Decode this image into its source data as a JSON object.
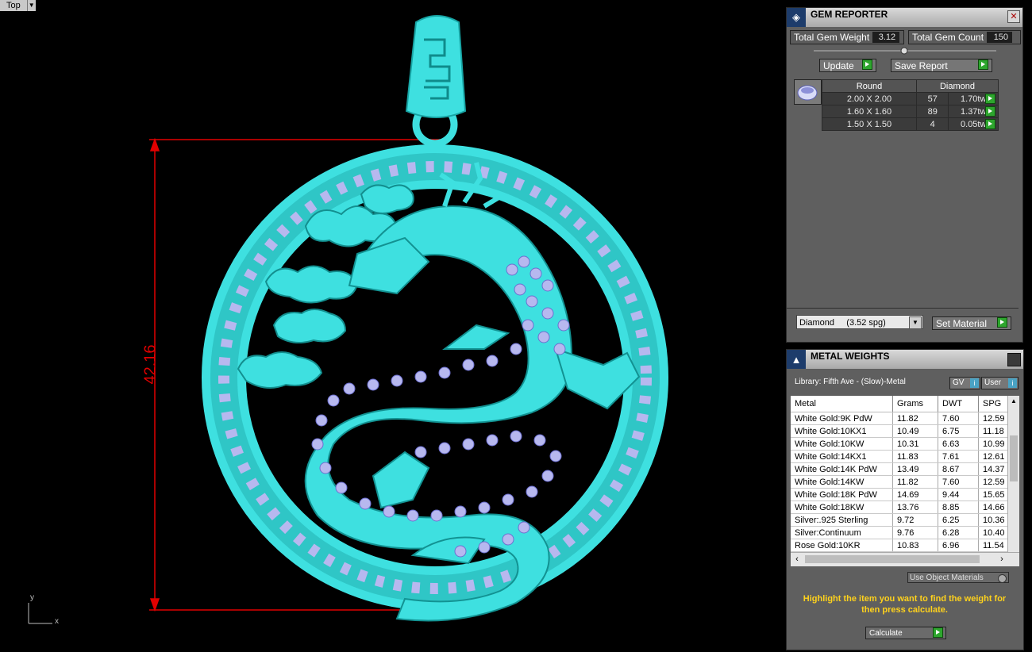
{
  "viewport": {
    "view_name": "Top",
    "dimension_value": "42.16",
    "axis_x": "x",
    "axis_y": "y",
    "model_color": "#3ee0e0",
    "dimension_color": "#e10000"
  },
  "gem_reporter": {
    "title": "GEM REPORTER",
    "total_weight_label": "Total Gem Weight",
    "total_weight_value": "3.12",
    "total_count_label": "Total Gem Count",
    "total_count_value": "150",
    "update_label": "Update",
    "save_report_label": "Save Report",
    "table": {
      "shape": "Round",
      "gem": "Diamond",
      "rows": [
        {
          "size": "2.00 X 2.00",
          "count": "57",
          "weight": "1.70tw"
        },
        {
          "size": "1.60 X 1.60",
          "count": "89",
          "weight": "1.37tw"
        },
        {
          "size": "1.50 X 1.50",
          "count": "4",
          "weight": "0.05tw"
        }
      ]
    },
    "material_select": "Diamond     (3.52 spg)",
    "set_material_label": "Set Material"
  },
  "metal_weights": {
    "title": "METAL WEIGHTS",
    "library": "Library: Fifth Ave - (Slow)-Metal",
    "gv_label": "GV",
    "user_label": "User",
    "columns": [
      "Metal",
      "Grams",
      "DWT",
      "SPG"
    ],
    "rows": [
      [
        "White Gold:9K PdW",
        "11.82",
        "7.60",
        "12.59"
      ],
      [
        "White Gold:10KX1",
        "10.49",
        "6.75",
        "11.18"
      ],
      [
        "White Gold:10KW",
        "10.31",
        "6.63",
        "10.99"
      ],
      [
        "White Gold:14KX1",
        "11.83",
        "7.61",
        "12.61"
      ],
      [
        "White Gold:14K PdW",
        "13.49",
        "8.67",
        "14.37"
      ],
      [
        "White Gold:14KW",
        "11.82",
        "7.60",
        "12.59"
      ],
      [
        "White Gold:18K PdW",
        "14.69",
        "9.44",
        "15.65"
      ],
      [
        "White Gold:18KW",
        "13.76",
        "8.85",
        "14.66"
      ],
      [
        "Silver:.925 Sterling",
        "9.72",
        "6.25",
        "10.36"
      ],
      [
        "Silver:Continuum",
        "9.76",
        "6.28",
        "10.40"
      ],
      [
        "Rose Gold:10KR",
        "10.83",
        "6.96",
        "11.54"
      ]
    ],
    "use_object_materials": "Use Object Materials",
    "hint": "Highlight the item you want to find the weight for then press calculate.",
    "calculate_label": "Calculate"
  }
}
